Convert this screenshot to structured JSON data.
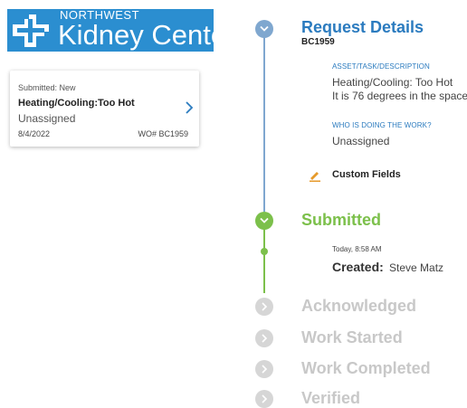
{
  "logo": {
    "line1": "NORTHWEST",
    "line2": "Kidney Centers",
    "color": "#2b8ed0"
  },
  "work_order_card": {
    "status": "Submitted: New",
    "title": "Heating/Cooling:Too Hot",
    "assignee": "Unassigned",
    "date": "8/4/2022",
    "wo_number": "WO# BC1959",
    "chevron_icon": "chevron-right-icon"
  },
  "timeline": {
    "request_details": {
      "title": "Request Details",
      "wo_id": "BC1959",
      "asset_label": "ASSET/TASK/DESCRIPTION",
      "asset_line1": "Heating/Cooling: Too Hot",
      "asset_line2": "It is 76 degrees in the space",
      "worker_label": "WHO IS DOING THE WORK?",
      "worker_value": "Unassigned",
      "custom_fields": "Custom Fields",
      "custom_fields_icon": "pencil-icon"
    },
    "submitted": {
      "title": "Submitted",
      "timestamp": "Today, 8:58 AM",
      "created_label": "Created:",
      "created_by": "Steve Matz"
    },
    "pending_steps": [
      "Acknowledged",
      "Work Started",
      "Work Completed",
      "Verified"
    ]
  },
  "colors": {
    "blue_accent": "#2b7bbf",
    "timeline_blue": "#7fa7cf",
    "green": "#7cc04b",
    "pending_gray": "#d6d6d6",
    "pending_text": "#c8c8c8",
    "pencil_orange": "#e69a2b"
  }
}
